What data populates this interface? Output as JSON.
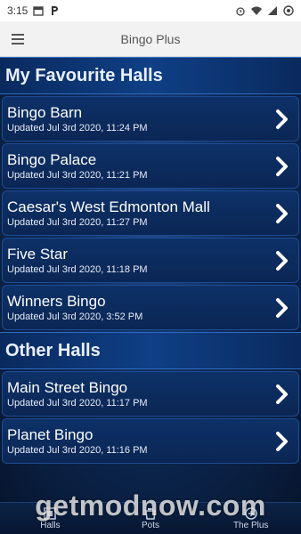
{
  "status_bar": {
    "time": "3:15",
    "left_icons": [
      "calendar-icon",
      "p-icon"
    ],
    "right_icons": [
      "alarm-icon",
      "wifi-icon",
      "signal-icon",
      "battery-icon"
    ]
  },
  "app_bar": {
    "title": "Bingo Plus",
    "menu_icon": "hamburger-icon"
  },
  "favourites": {
    "header": "My Favourite Halls",
    "halls": [
      {
        "name": "Bingo Barn",
        "updated": "Updated Jul 3rd 2020, 11:24 PM"
      },
      {
        "name": "Bingo Palace",
        "updated": "Updated Jul 3rd 2020, 11:21 PM"
      },
      {
        "name": "Caesar's West Edmonton Mall",
        "updated": "Updated Jul 3rd 2020, 11:27 PM"
      },
      {
        "name": "Five Star",
        "updated": "Updated Jul 3rd 2020, 11:18 PM"
      },
      {
        "name": "Winners Bingo",
        "updated": "Updated Jul 3rd 2020, 3:52 PM"
      }
    ]
  },
  "other": {
    "header": "Other Halls",
    "halls": [
      {
        "name": "Main Street Bingo",
        "updated": "Updated Jul 3rd 2020, 11:17 PM"
      },
      {
        "name": "Planet Bingo",
        "updated": "Updated Jul 3rd 2020, 11:16 PM"
      }
    ]
  },
  "bottom_nav": [
    {
      "label": "Halls",
      "icon": "halls-icon"
    },
    {
      "label": "Pots",
      "icon": "pots-icon"
    },
    {
      "label": "The Plus",
      "icon": "plus-icon"
    }
  ],
  "watermark": "getmodnow.com",
  "colors": {
    "accent": "#0f3f86",
    "background": "#07162f",
    "text": "#ffffff"
  }
}
